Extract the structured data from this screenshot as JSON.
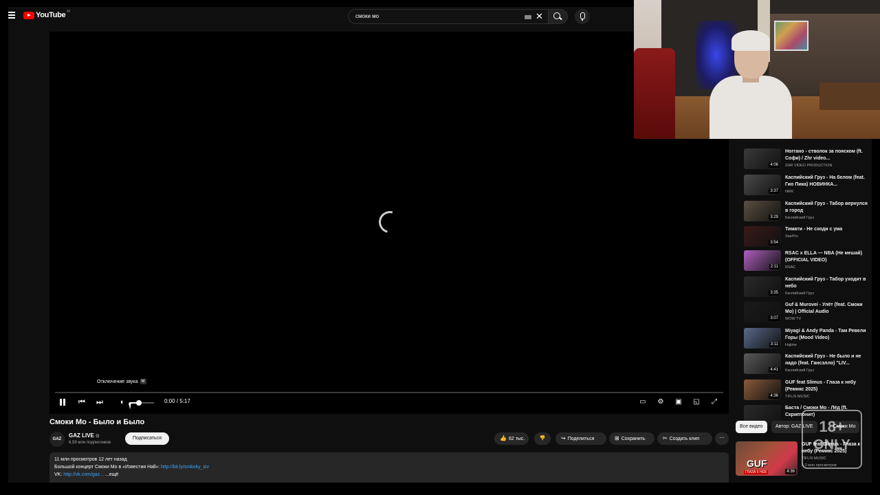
{
  "header": {
    "logo_text": "YouTube",
    "logo_country": "FI",
    "search_value": "смоки мо"
  },
  "player": {
    "tooltip_label": "Отключение звука",
    "tooltip_key": "M",
    "time": "0:00 / 5:17",
    "progress_fraction": 0,
    "volume_fraction": 0.4
  },
  "video": {
    "title": "Смоки Мо - Было и Было",
    "channel": "GAZ LIVE",
    "avatar_text": "GAZ",
    "subscribers": "6,59 млн подписчиков",
    "subscribe_label": "Подписаться",
    "likes": "62 тыс.",
    "share_label": "Поделиться",
    "save_label": "Сохранить",
    "clip_label": "Создать клип",
    "views_line": "11 млн просмотров  12 лет назад",
    "desc_prefix": "Большой концерт Смоки Мо в «Известия Hall»: ",
    "desc_link": "http://bit.ly/smkoky_izv",
    "desc_line3_prefix": "VK: ",
    "desc_line3_link": "http://vk.com/gaz...",
    "desc_line3_suffix": "  ...ещё"
  },
  "sidebar": {
    "items": [
      {
        "title": "Ноггано - стволок за пояском (ft. Софи) / Zhr video...",
        "channel": "ZHR VIDEO PRODUCTION",
        "duration": "4:06",
        "color": "#3a3a3a"
      },
      {
        "title": "Каспийский Груз - На белом (feat. Гио Пика) НОВИНКА...",
        "channel": "NRR",
        "duration": "3:37",
        "color": "#4a4a4a"
      },
      {
        "title": "Каспийский Груз - Табор вернулся в город",
        "channel": "Каспийский Груз",
        "duration": "3:29",
        "color": "#5a5040"
      },
      {
        "title": "Тимати - Не сходи с ума",
        "channel": "StarPro",
        "duration": "3:54",
        "color": "#3a1a1a"
      },
      {
        "title": "RSAC x ELLA — NBA (Не мешай) (OFFICIAL VIDEO)",
        "channel": "RSAC",
        "duration": "2:11",
        "color": "#b060c0"
      },
      {
        "title": "Каспийский Груз - Табор уходит в небо",
        "channel": "Каспийский Груз",
        "duration": "3:35",
        "color": "#2a2a2a"
      },
      {
        "title": "Guf & Murovei - Улёт (feat. Смоки Мо) | Official Audio",
        "channel": "WOW TV",
        "duration": "3:07",
        "color": "#1a1a1a"
      },
      {
        "title": "Miyagi & Andy Panda - Там Ревели Горы (Mood Video)",
        "channel": "Hajime",
        "duration": "3:11",
        "color": "#5a6a8a"
      },
      {
        "title": "Каспийский Груз - Не было и не надо (feat. Гансэлло) \"LIV...",
        "channel": "Каспийский Груз",
        "duration": "4:41",
        "color": "#5a5a5a"
      },
      {
        "title": "GUF feat Slimus - Глаза к небу (Ремикс 2025)",
        "channel": "TIFLIS MUSIC",
        "duration": "4:36",
        "color": "#8a5a3a"
      },
      {
        "title": "Баста / Смоки Мо - Лёд (ft. Скриптонит)",
        "channel": "",
        "duration": "",
        "color": "#2a2a2a"
      }
    ],
    "chip_all": "Все видео",
    "chip_author": "Автор: GAZ LIVE",
    "chip_more": "Смоки Мо",
    "bottom_title": "GUF feat Slimus - Глаза к небу (Ремикс 2025)",
    "bottom_channel": "TIFLIS MUSIC",
    "bottom_meta": "1,2 млн просмотров",
    "bottom_duration": "4:36",
    "bottom_thumb_text": "GUF",
    "bottom_thumb_sub": "ГЛАЗА К НЕБ"
  },
  "overlay": {
    "age_badge_num": "18+",
    "age_badge_text": "ONLY"
  }
}
